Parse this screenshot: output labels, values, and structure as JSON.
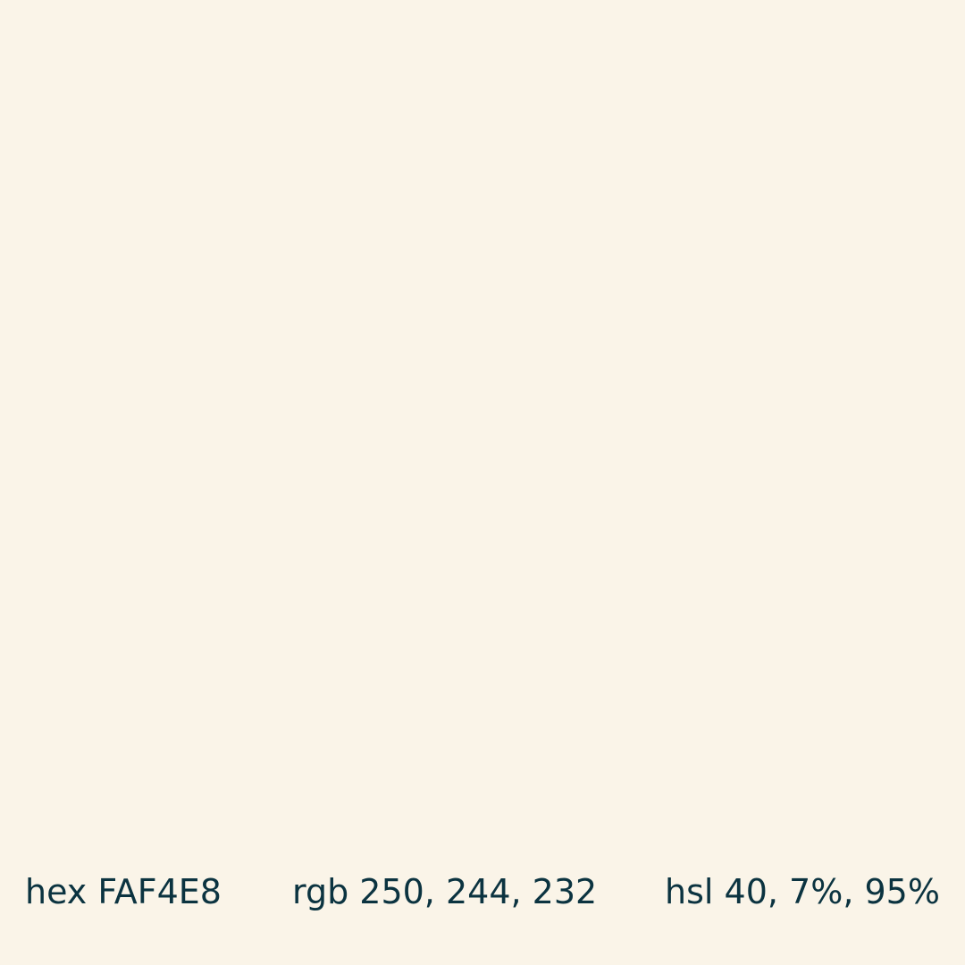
{
  "swatch": {
    "background_color": "#FAF4E8",
    "text_color": "#0B3340"
  },
  "labels": {
    "hex": "hex FAF4E8",
    "rgb": "rgb 250, 244, 232",
    "hsl": "hsl 40, 7%, 95%"
  }
}
